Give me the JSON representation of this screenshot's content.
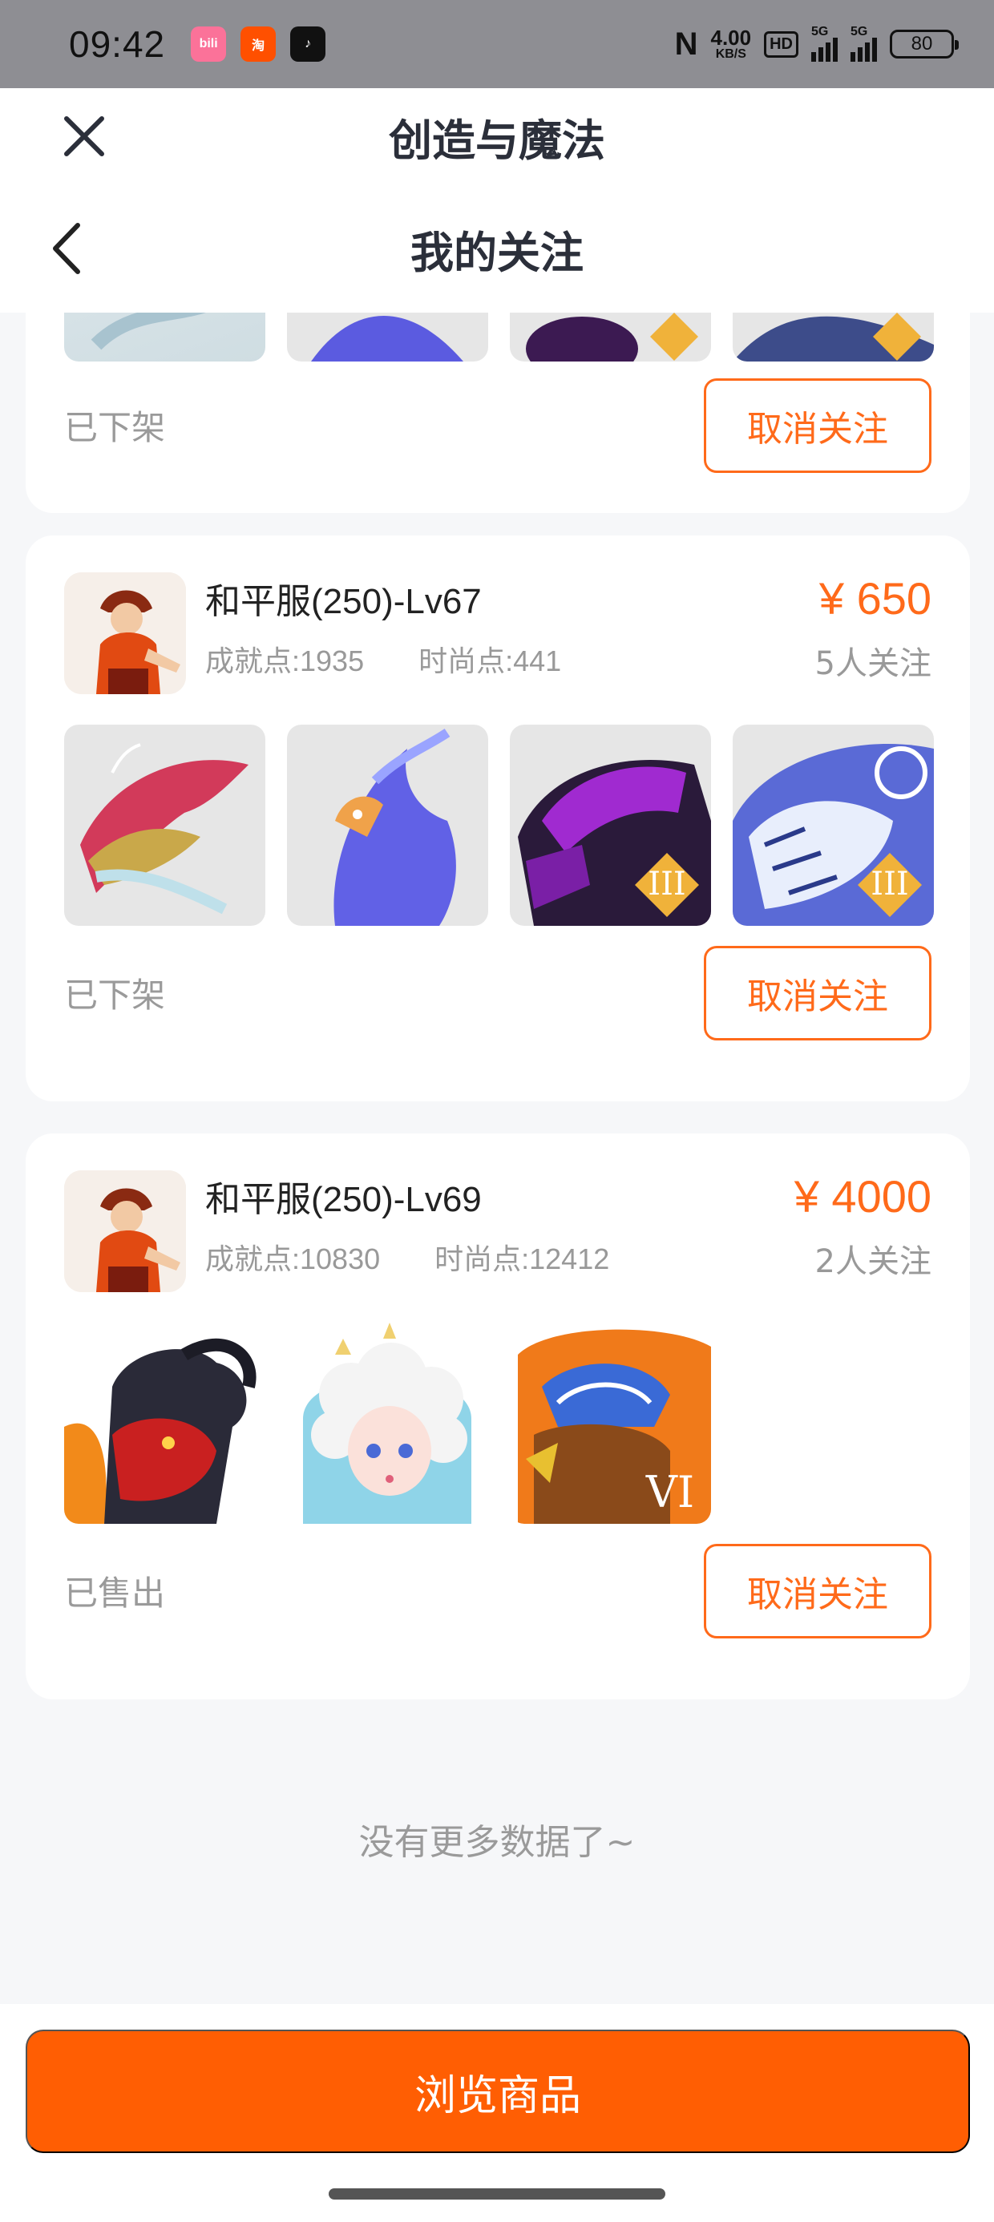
{
  "status_bar": {
    "time": "09:42",
    "apps": [
      {
        "label": "bili",
        "color": "#fb7299"
      },
      {
        "label": "淘",
        "color": "#ff5000"
      },
      {
        "label": "♪",
        "color": "#111111"
      }
    ],
    "nfc": "N",
    "speed_value": "4.00",
    "speed_unit": "KB/S",
    "hd": "HD",
    "signal1": "5G",
    "signal2": "5G",
    "battery": "80"
  },
  "nav": {
    "app_title": "创造与魔法",
    "page_title": "我的关注",
    "close_icon": "close-icon",
    "back_icon": "chevron-left-icon"
  },
  "listings": [
    {
      "status": "已下架",
      "unfollow_label": "取消关注",
      "thumbs": [
        "dragon-image",
        "phoenix-image",
        "dark-beast-image",
        "ice-tiger-image"
      ]
    },
    {
      "name": "和平服(250)-Lv67",
      "achievement": "成就点:1935",
      "fashion": "时尚点:441",
      "price": "¥ 650",
      "followers": "5人关注",
      "status": "已下架",
      "unfollow_label": "取消关注",
      "thumbs": [
        "dragon-image",
        "phoenix-image",
        "dark-beast-image",
        "ice-tiger-image"
      ],
      "tier_badges": [
        "",
        "",
        "III",
        "III"
      ]
    },
    {
      "name": "和平服(250)-Lv69",
      "achievement": "成就点:10830",
      "fashion": "时尚点:12412",
      "price": "¥ 4000",
      "followers": "2人关注",
      "status": "已售出",
      "unfollow_label": "取消关注",
      "thumbs": [
        "ram-beast-image",
        "cloud-doll-image",
        "fire-wolf-image"
      ],
      "tier_badges": [
        "",
        "",
        "VI"
      ]
    }
  ],
  "no_more": "没有更多数据了~",
  "browse_button": "浏览商品",
  "colors": {
    "accent": "#ff6a1a",
    "button_bg": "#ff5e03",
    "page_bg": "#f6f7f9"
  }
}
